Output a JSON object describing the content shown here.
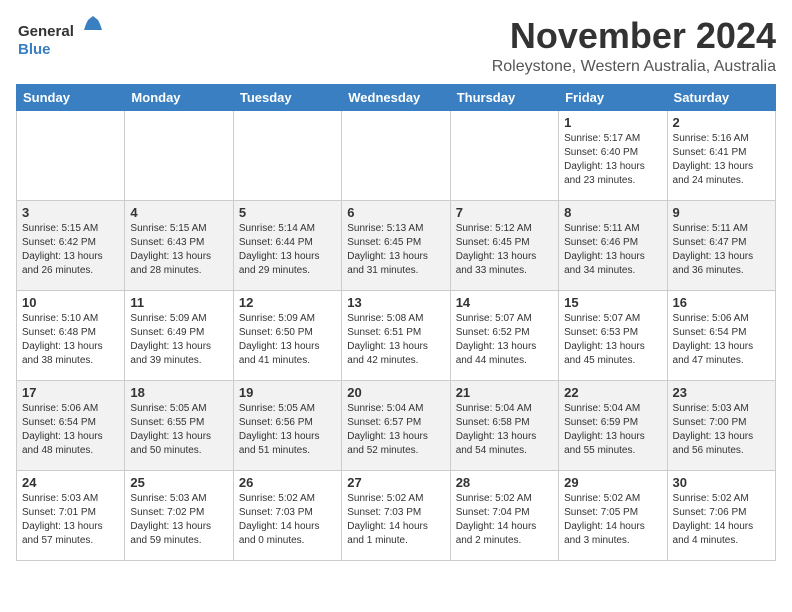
{
  "header": {
    "logo_general": "General",
    "logo_blue": "Blue",
    "month": "November 2024",
    "location": "Roleystone, Western Australia, Australia"
  },
  "days_of_week": [
    "Sunday",
    "Monday",
    "Tuesday",
    "Wednesday",
    "Thursday",
    "Friday",
    "Saturday"
  ],
  "weeks": [
    [
      {
        "day": "",
        "info": ""
      },
      {
        "day": "",
        "info": ""
      },
      {
        "day": "",
        "info": ""
      },
      {
        "day": "",
        "info": ""
      },
      {
        "day": "",
        "info": ""
      },
      {
        "day": "1",
        "info": "Sunrise: 5:17 AM\nSunset: 6:40 PM\nDaylight: 13 hours\nand 23 minutes."
      },
      {
        "day": "2",
        "info": "Sunrise: 5:16 AM\nSunset: 6:41 PM\nDaylight: 13 hours\nand 24 minutes."
      }
    ],
    [
      {
        "day": "3",
        "info": "Sunrise: 5:15 AM\nSunset: 6:42 PM\nDaylight: 13 hours\nand 26 minutes."
      },
      {
        "day": "4",
        "info": "Sunrise: 5:15 AM\nSunset: 6:43 PM\nDaylight: 13 hours\nand 28 minutes."
      },
      {
        "day": "5",
        "info": "Sunrise: 5:14 AM\nSunset: 6:44 PM\nDaylight: 13 hours\nand 29 minutes."
      },
      {
        "day": "6",
        "info": "Sunrise: 5:13 AM\nSunset: 6:45 PM\nDaylight: 13 hours\nand 31 minutes."
      },
      {
        "day": "7",
        "info": "Sunrise: 5:12 AM\nSunset: 6:45 PM\nDaylight: 13 hours\nand 33 minutes."
      },
      {
        "day": "8",
        "info": "Sunrise: 5:11 AM\nSunset: 6:46 PM\nDaylight: 13 hours\nand 34 minutes."
      },
      {
        "day": "9",
        "info": "Sunrise: 5:11 AM\nSunset: 6:47 PM\nDaylight: 13 hours\nand 36 minutes."
      }
    ],
    [
      {
        "day": "10",
        "info": "Sunrise: 5:10 AM\nSunset: 6:48 PM\nDaylight: 13 hours\nand 38 minutes."
      },
      {
        "day": "11",
        "info": "Sunrise: 5:09 AM\nSunset: 6:49 PM\nDaylight: 13 hours\nand 39 minutes."
      },
      {
        "day": "12",
        "info": "Sunrise: 5:09 AM\nSunset: 6:50 PM\nDaylight: 13 hours\nand 41 minutes."
      },
      {
        "day": "13",
        "info": "Sunrise: 5:08 AM\nSunset: 6:51 PM\nDaylight: 13 hours\nand 42 minutes."
      },
      {
        "day": "14",
        "info": "Sunrise: 5:07 AM\nSunset: 6:52 PM\nDaylight: 13 hours\nand 44 minutes."
      },
      {
        "day": "15",
        "info": "Sunrise: 5:07 AM\nSunset: 6:53 PM\nDaylight: 13 hours\nand 45 minutes."
      },
      {
        "day": "16",
        "info": "Sunrise: 5:06 AM\nSunset: 6:54 PM\nDaylight: 13 hours\nand 47 minutes."
      }
    ],
    [
      {
        "day": "17",
        "info": "Sunrise: 5:06 AM\nSunset: 6:54 PM\nDaylight: 13 hours\nand 48 minutes."
      },
      {
        "day": "18",
        "info": "Sunrise: 5:05 AM\nSunset: 6:55 PM\nDaylight: 13 hours\nand 50 minutes."
      },
      {
        "day": "19",
        "info": "Sunrise: 5:05 AM\nSunset: 6:56 PM\nDaylight: 13 hours\nand 51 minutes."
      },
      {
        "day": "20",
        "info": "Sunrise: 5:04 AM\nSunset: 6:57 PM\nDaylight: 13 hours\nand 52 minutes."
      },
      {
        "day": "21",
        "info": "Sunrise: 5:04 AM\nSunset: 6:58 PM\nDaylight: 13 hours\nand 54 minutes."
      },
      {
        "day": "22",
        "info": "Sunrise: 5:04 AM\nSunset: 6:59 PM\nDaylight: 13 hours\nand 55 minutes."
      },
      {
        "day": "23",
        "info": "Sunrise: 5:03 AM\nSunset: 7:00 PM\nDaylight: 13 hours\nand 56 minutes."
      }
    ],
    [
      {
        "day": "24",
        "info": "Sunrise: 5:03 AM\nSunset: 7:01 PM\nDaylight: 13 hours\nand 57 minutes."
      },
      {
        "day": "25",
        "info": "Sunrise: 5:03 AM\nSunset: 7:02 PM\nDaylight: 13 hours\nand 59 minutes."
      },
      {
        "day": "26",
        "info": "Sunrise: 5:02 AM\nSunset: 7:03 PM\nDaylight: 14 hours\nand 0 minutes."
      },
      {
        "day": "27",
        "info": "Sunrise: 5:02 AM\nSunset: 7:03 PM\nDaylight: 14 hours\nand 1 minute."
      },
      {
        "day": "28",
        "info": "Sunrise: 5:02 AM\nSunset: 7:04 PM\nDaylight: 14 hours\nand 2 minutes."
      },
      {
        "day": "29",
        "info": "Sunrise: 5:02 AM\nSunset: 7:05 PM\nDaylight: 14 hours\nand 3 minutes."
      },
      {
        "day": "30",
        "info": "Sunrise: 5:02 AM\nSunset: 7:06 PM\nDaylight: 14 hours\nand 4 minutes."
      }
    ]
  ]
}
